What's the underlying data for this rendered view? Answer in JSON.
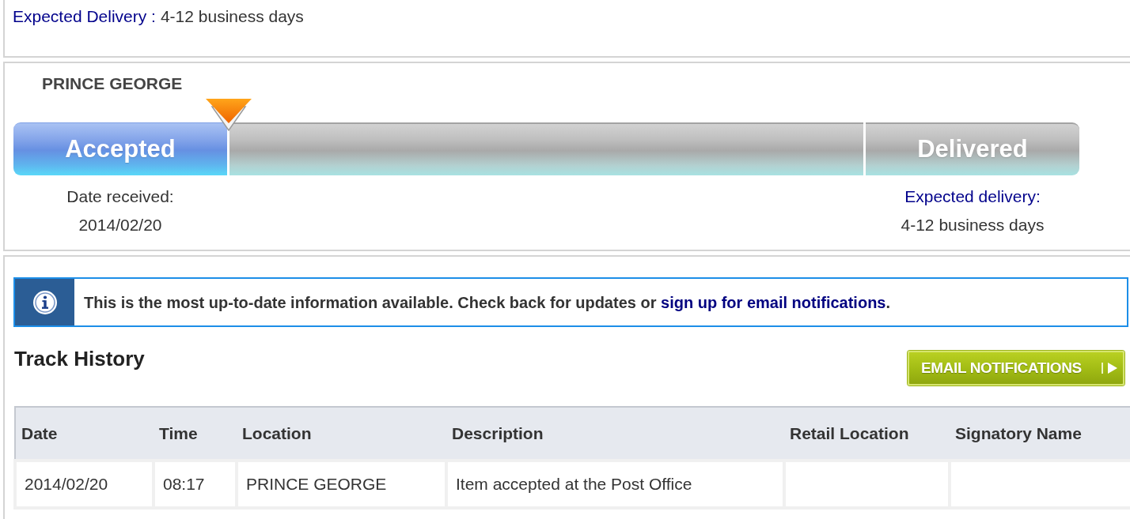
{
  "delivery_summary": {
    "label": "Expected Delivery :",
    "value": "4-12 business days"
  },
  "progress": {
    "location": "PRINCE GEORGE",
    "stages": [
      {
        "label": "Accepted",
        "reached": true,
        "current": true,
        "caption": {
          "text": "Date received:",
          "kind": "plain"
        },
        "detail": "2014/02/20"
      },
      {
        "reached": false,
        "current": false
      },
      {
        "label": "Delivered",
        "reached": false,
        "current": false,
        "caption": {
          "text": "Expected delivery:",
          "kind": "link"
        },
        "detail": "4-12 business days"
      }
    ]
  },
  "info_banner": {
    "message": "This is the most up-to-date information available. Check back for updates or ",
    "link": "sign up for email notifications",
    "end": "."
  },
  "track_history": {
    "title": "Track History",
    "button": {
      "label": "EMAIL NOTIFICATIONS"
    },
    "table": {
      "columns": [
        "Date",
        "Time",
        "Location",
        "Description",
        "Retail Location",
        "Signatory Name"
      ],
      "rows": [
        {
          "cells": [
            "2014/02/20",
            "08:17",
            "PRINCE GEORGE",
            "Item accepted at the Post Office"
          ]
        }
      ]
    }
  }
}
